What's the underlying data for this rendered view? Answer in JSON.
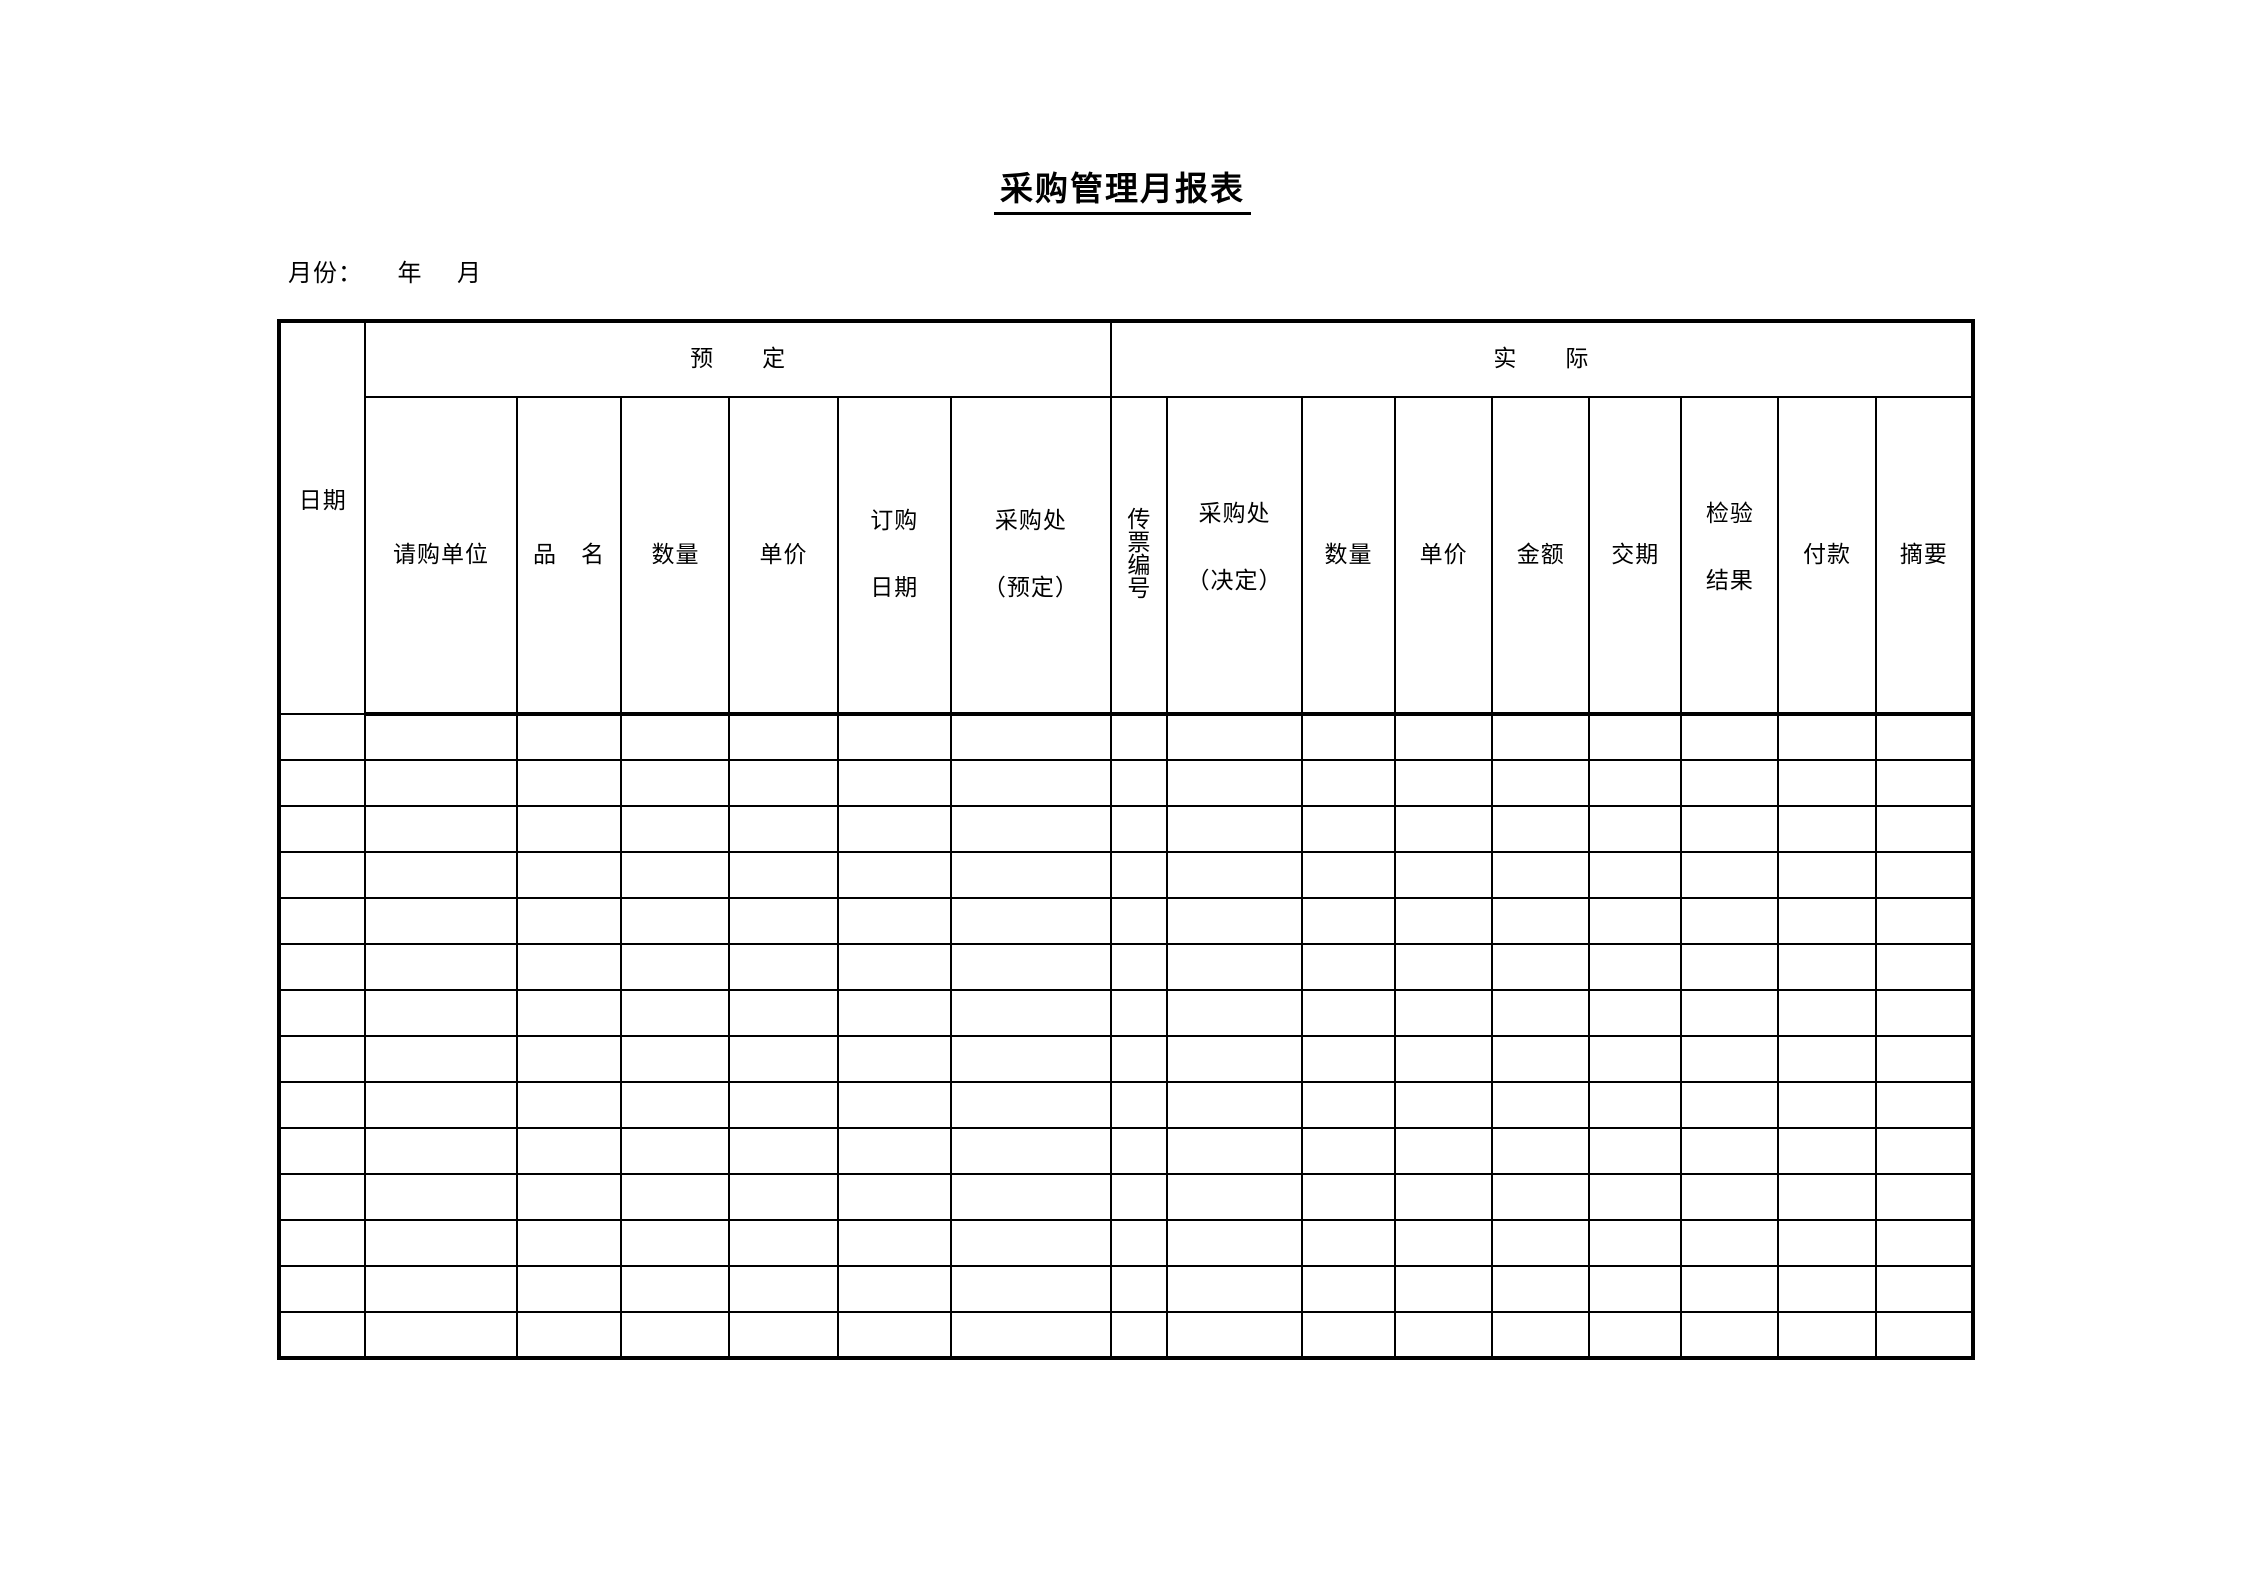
{
  "document": {
    "title": "采购管理月报表",
    "month_line": "月份：    年    月"
  },
  "table": {
    "group_headers": [
      {
        "label": "",
        "span": 1
      },
      {
        "label": "预　　定",
        "span": 6
      },
      {
        "label": "实　　际",
        "span": 9
      }
    ],
    "columns": [
      {
        "key": "date",
        "label": "日期",
        "lines": [
          "日期"
        ],
        "style": "single-raise"
      },
      {
        "key": "requesting_unit",
        "label": "请购单位",
        "lines": [
          "请购单位"
        ],
        "style": "single"
      },
      {
        "key": "item_name",
        "label": "品　名",
        "lines": [
          "品　名"
        ],
        "style": "single"
      },
      {
        "key": "plan_quantity",
        "label": "数量",
        "lines": [
          "数量"
        ],
        "style": "single"
      },
      {
        "key": "plan_unit_price",
        "label": "单价",
        "lines": [
          "单价"
        ],
        "style": "single"
      },
      {
        "key": "order_date",
        "label": "订购日期",
        "lines": [
          "订购",
          "日期"
        ],
        "style": "two-line"
      },
      {
        "key": "buyer_planned",
        "label": "采购处（预定）",
        "lines": [
          "采购处",
          "（预定）"
        ],
        "style": "two-line"
      },
      {
        "key": "voucher_no",
        "label": "传票编号",
        "lines": [
          "传",
          "票",
          "编",
          "号"
        ],
        "style": "vertical"
      },
      {
        "key": "buyer_decided",
        "label": "采购处（决定）",
        "lines": [
          "采购处",
          "（决定）"
        ],
        "style": "two-line-raise"
      },
      {
        "key": "act_quantity",
        "label": "数量",
        "lines": [
          "数量"
        ],
        "style": "single"
      },
      {
        "key": "act_unit_price",
        "label": "单价",
        "lines": [
          "单价"
        ],
        "style": "single"
      },
      {
        "key": "amount",
        "label": "金额",
        "lines": [
          "金额"
        ],
        "style": "single"
      },
      {
        "key": "delivery_date",
        "label": "交期",
        "lines": [
          "交期"
        ],
        "style": "single"
      },
      {
        "key": "inspection",
        "label": "检验结果",
        "lines": [
          "检验",
          "结果"
        ],
        "style": "two-line-raise"
      },
      {
        "key": "payment",
        "label": "付款",
        "lines": [
          "付款"
        ],
        "style": "single"
      },
      {
        "key": "remarks",
        "label": "摘要",
        "lines": [
          "摘要"
        ],
        "style": "single"
      }
    ],
    "data_row_count": 14,
    "data_rows": [
      [
        "",
        "",
        "",
        "",
        "",
        "",
        "",
        "",
        "",
        "",
        "",
        "",
        "",
        "",
        "",
        ""
      ],
      [
        "",
        "",
        "",
        "",
        "",
        "",
        "",
        "",
        "",
        "",
        "",
        "",
        "",
        "",
        "",
        ""
      ],
      [
        "",
        "",
        "",
        "",
        "",
        "",
        "",
        "",
        "",
        "",
        "",
        "",
        "",
        "",
        "",
        ""
      ],
      [
        "",
        "",
        "",
        "",
        "",
        "",
        "",
        "",
        "",
        "",
        "",
        "",
        "",
        "",
        "",
        ""
      ],
      [
        "",
        "",
        "",
        "",
        "",
        "",
        "",
        "",
        "",
        "",
        "",
        "",
        "",
        "",
        "",
        ""
      ],
      [
        "",
        "",
        "",
        "",
        "",
        "",
        "",
        "",
        "",
        "",
        "",
        "",
        "",
        "",
        "",
        ""
      ],
      [
        "",
        "",
        "",
        "",
        "",
        "",
        "",
        "",
        "",
        "",
        "",
        "",
        "",
        "",
        "",
        ""
      ],
      [
        "",
        "",
        "",
        "",
        "",
        "",
        "",
        "",
        "",
        "",
        "",
        "",
        "",
        "",
        "",
        ""
      ],
      [
        "",
        "",
        "",
        "",
        "",
        "",
        "",
        "",
        "",
        "",
        "",
        "",
        "",
        "",
        "",
        ""
      ],
      [
        "",
        "",
        "",
        "",
        "",
        "",
        "",
        "",
        "",
        "",
        "",
        "",
        "",
        "",
        "",
        ""
      ],
      [
        "",
        "",
        "",
        "",
        "",
        "",
        "",
        "",
        "",
        "",
        "",
        "",
        "",
        "",
        "",
        ""
      ],
      [
        "",
        "",
        "",
        "",
        "",
        "",
        "",
        "",
        "",
        "",
        "",
        "",
        "",
        "",
        "",
        ""
      ],
      [
        "",
        "",
        "",
        "",
        "",
        "",
        "",
        "",
        "",
        "",
        "",
        "",
        "",
        "",
        "",
        ""
      ],
      [
        "",
        "",
        "",
        "",
        "",
        "",
        "",
        "",
        "",
        "",
        "",
        "",
        "",
        "",
        "",
        ""
      ]
    ]
  },
  "colors": {
    "ink": "#000000",
    "paper": "#ffffff"
  }
}
